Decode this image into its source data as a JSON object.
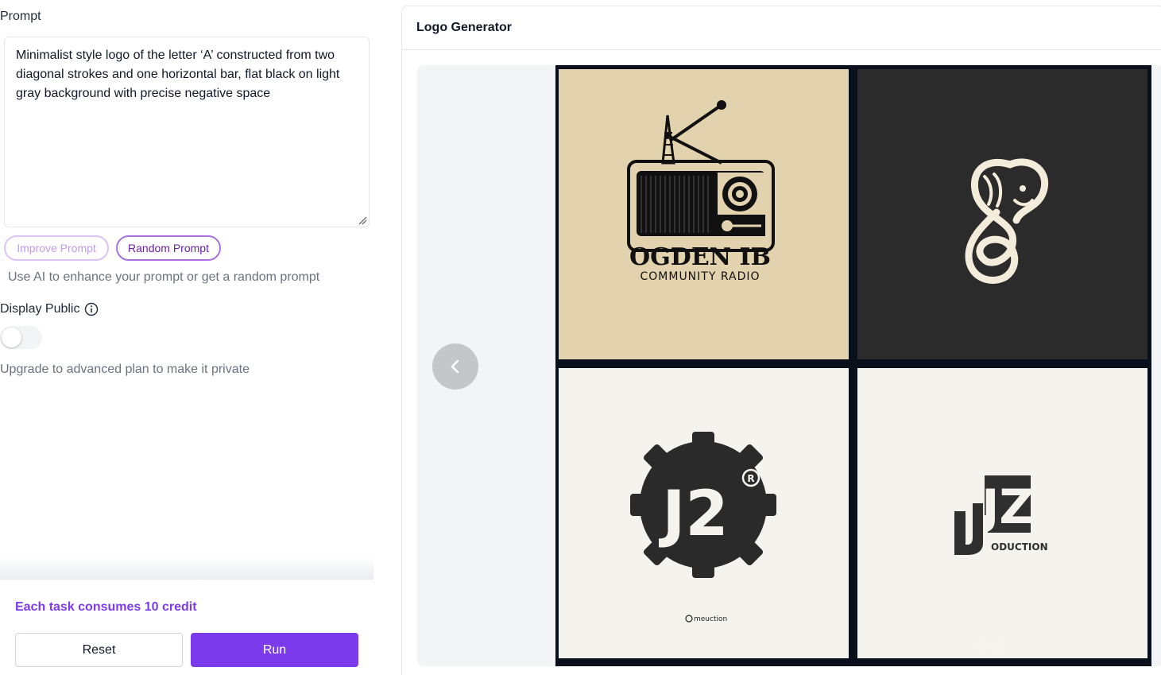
{
  "prompt": {
    "label": "Prompt",
    "value": "Minimalist style logo of the letter ‘A’ constructed from two diagonal strokes and one horizontal bar, flat black on light gray background with precise negative space"
  },
  "actions": {
    "improve_label": "Improve Prompt",
    "random_label": "Random Prompt",
    "hint": "Use AI to enhance your prompt or get a random prompt"
  },
  "display_public": {
    "label": "Display Public",
    "enabled": false,
    "upgrade_note": "Upgrade to advanced plan to make it private"
  },
  "footer": {
    "credit_note": "Each task consumes 10 credit",
    "reset_label": "Reset",
    "run_label": "Run"
  },
  "panel": {
    "title": "Logo Generator"
  },
  "gallery": {
    "images": [
      {
        "name": "ogden-radio-logo",
        "line1": "OGDEN IB",
        "line2": "COMMUNITY RADIO"
      },
      {
        "name": "seahorse-logo"
      },
      {
        "name": "j2-gear-logo",
        "mark": "J2",
        "small": "meuction"
      },
      {
        "name": "jz-production-logo",
        "mark": "JZ",
        "word": "ODUCTION"
      }
    ]
  },
  "colors": {
    "accent": "#7c3aed",
    "accent_light": "#dcc3f3"
  }
}
